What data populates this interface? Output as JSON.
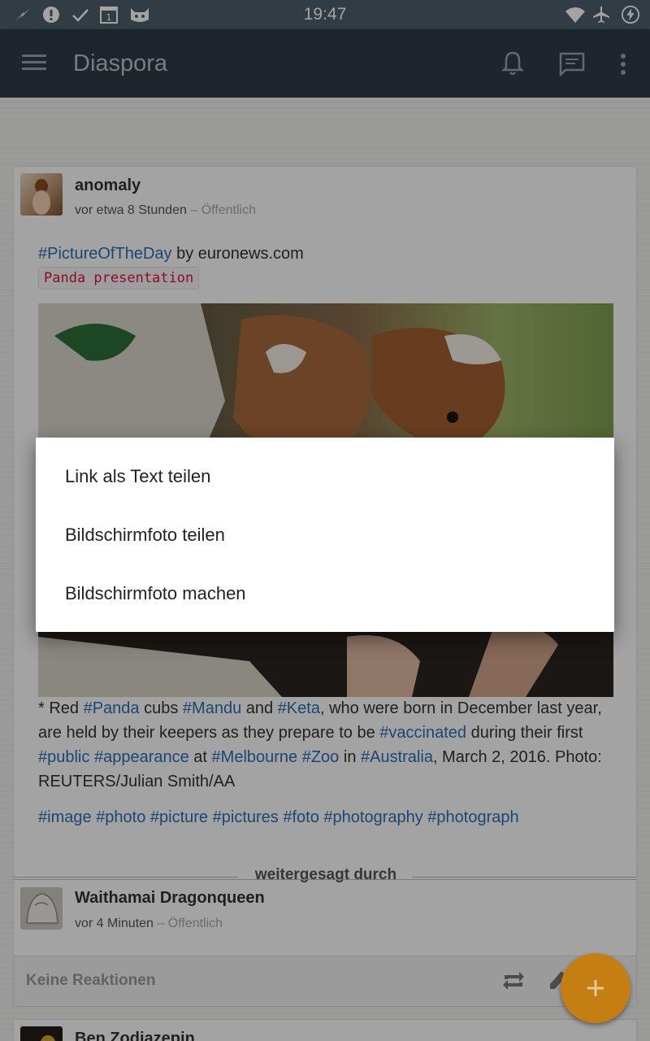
{
  "status_bar": {
    "time": "19:47"
  },
  "app_bar": {
    "title": "Diaspora"
  },
  "post": {
    "author": "anomaly",
    "time": "vor etwa 8 Stunden",
    "visibility_sep": "–",
    "visibility": "Öffentlich",
    "line1_tag": "#PictureOfTheDay",
    "line1_rest": " by euronews.com",
    "code_label": "Panda presentation",
    "caption": {
      "p1": "* Red ",
      "t1": "#Panda",
      "p2": " cubs ",
      "t2": "#Mandu",
      "p3": " and ",
      "t3": "#Keta",
      "p4": ", who were born in December last year, are held by their keepers as they prepare to be ",
      "t4": "#vaccinated",
      "p5": " during their first ",
      "t5": "#public",
      "p6": " ",
      "t6": "#appearance",
      "p7": " at ",
      "t7": "#Melbourne",
      "p8": " ",
      "t8": "#Zoo",
      "p9": " in ",
      "t9": "#Australia",
      "p10": ", March 2, 2016. Photo: REUTERS/Julian Smith/AA"
    },
    "tags": [
      "#image",
      "#photo",
      "#picture",
      "#pictures",
      "#foto",
      "#photography",
      "#photograph"
    ],
    "reshare_label": "weitergesagt durch",
    "resharer": {
      "name": "Waithamai Dragonqueen",
      "time": "vor 4 Minuten",
      "visibility_sep": "–",
      "visibility": "Öffentlich"
    },
    "reactions": "Keine Reaktionen"
  },
  "next_post": {
    "author": "Ben Zodiazepin"
  },
  "context_menu": {
    "items": [
      "Link als Text teilen",
      "Bildschirmfoto teilen",
      "Bildschirmfoto machen"
    ]
  },
  "fab": {
    "icon": "plus-icon",
    "color": "#c57e12"
  },
  "colors": {
    "status_bar": "#4d5f6b",
    "app_bar": "#2e3c46",
    "hashtag": "#2b70b3",
    "code_text": "#dd1144"
  }
}
